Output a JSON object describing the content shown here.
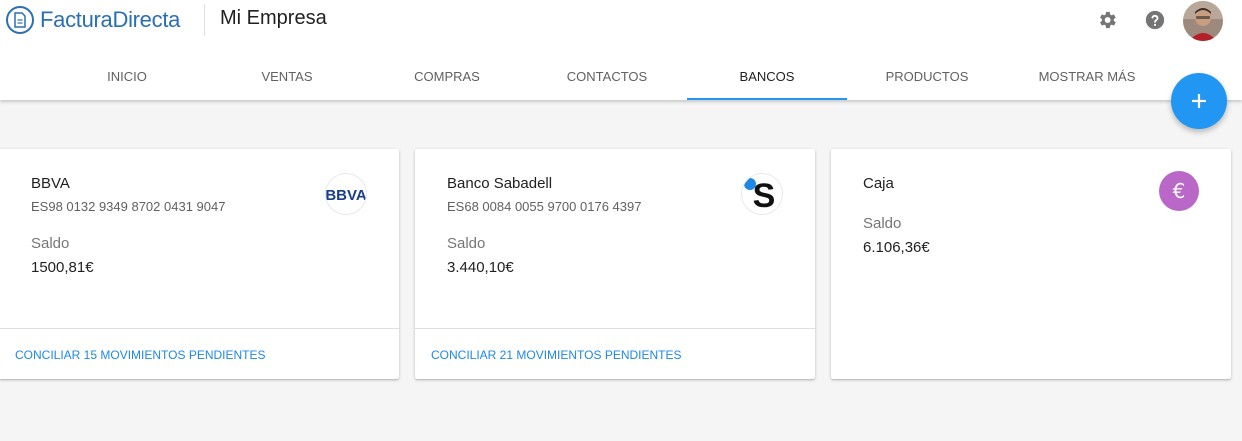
{
  "header": {
    "logo_text": "FacturaDirecta",
    "company_name": "Mi Empresa",
    "icons": {
      "settings": "gear-icon",
      "help": "help-circle-icon"
    }
  },
  "tabs": [
    {
      "label": "INICIO"
    },
    {
      "label": "VENTAS"
    },
    {
      "label": "COMPRAS"
    },
    {
      "label": "CONTACTOS"
    },
    {
      "label": "BANCOS",
      "active": true
    },
    {
      "label": "PRODUCTOS"
    },
    {
      "label": "MOSTRAR MÁS"
    }
  ],
  "fab": {
    "icon": "plus-icon"
  },
  "accounts": [
    {
      "name": "BBVA",
      "iban": "ES98 0132 9349 8702 0431 9047",
      "saldo_label": "Saldo",
      "saldo": "1500,81€",
      "logo_text": "BBVA",
      "action": "CONCILIAR 15 MOVIMIENTOS PENDIENTES"
    },
    {
      "name": "Banco Sabadell",
      "iban": "ES68 0084 0055 9700 0176 4397",
      "saldo_label": "Saldo",
      "saldo": "3.440,10€",
      "logo_text": "S",
      "action": "CONCILIAR 21 MOVIMIENTOS PENDIENTES"
    },
    {
      "name": "Caja",
      "saldo_label": "Saldo",
      "saldo": "6.106,36€",
      "logo_text": "€"
    }
  ],
  "colors": {
    "accent": "#2196f3",
    "link": "#1e88e5",
    "brand": "#2a6fb6",
    "bbva": "#1a3e8c",
    "caja": "#ba68c8"
  }
}
